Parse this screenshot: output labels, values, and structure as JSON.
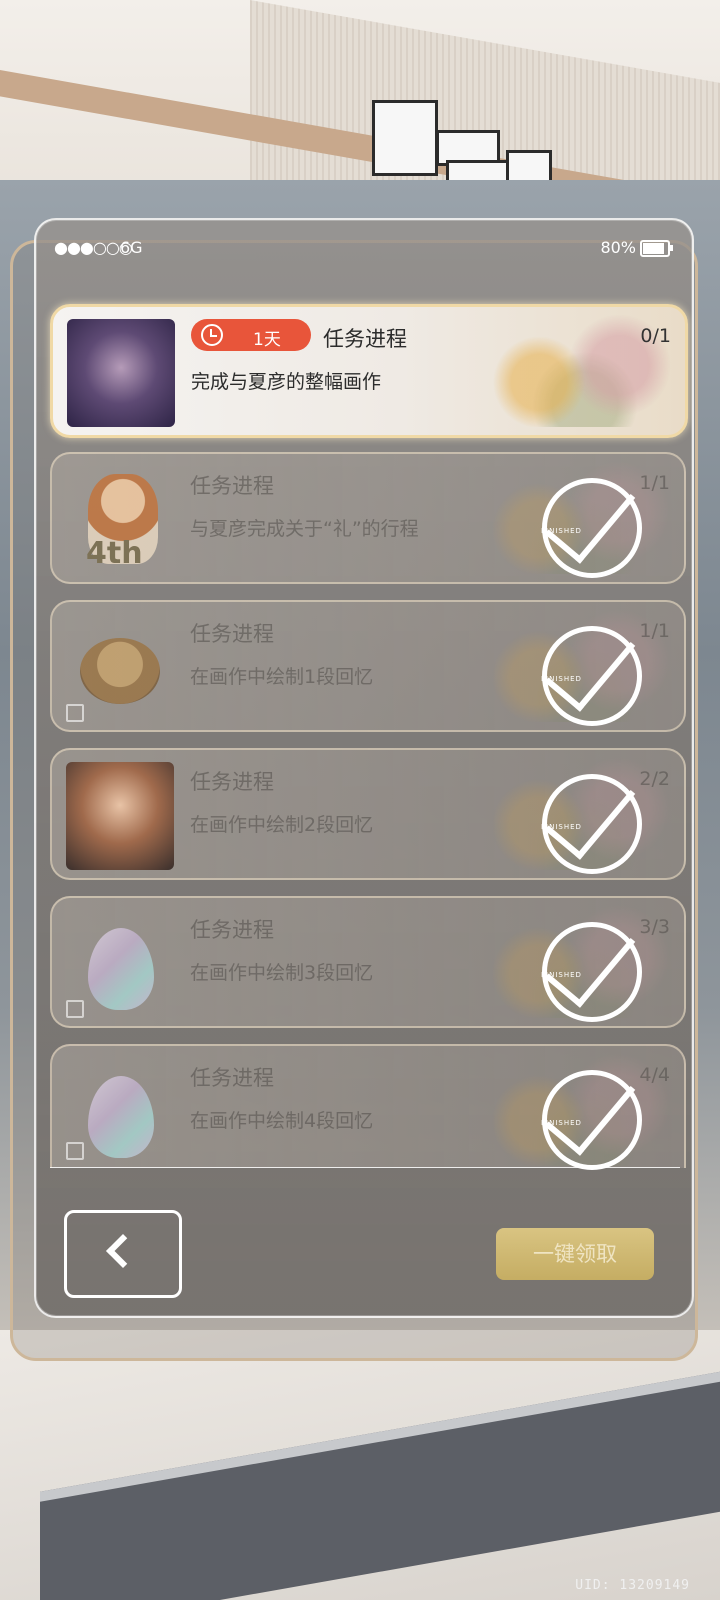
{
  "status_bar": {
    "signal": "●●●○○○",
    "network": "6G",
    "battery": "80%"
  },
  "tasks": [
    {
      "timer": "1天",
      "title": "任务进程",
      "description": "完成与夏彦的整幅画作",
      "progress": "0/1",
      "finished": false,
      "thumb": "portrait-icon"
    },
    {
      "title": "任务进程",
      "description": "与夏彦完成关于“礼”的行程",
      "progress": "1/1",
      "finished": true,
      "thumb": "chibi-4th-icon",
      "thumb_label": "4th"
    },
    {
      "title": "任务进程",
      "description": "在画作中绘制1段回忆",
      "progress": "1/1",
      "finished": true,
      "thumb": "cake-icon"
    },
    {
      "title": "任务进程",
      "description": "在画作中绘制2段回忆",
      "progress": "2/2",
      "finished": true,
      "thumb": "portrait-icon"
    },
    {
      "title": "任务进程",
      "description": "在画作中绘制3段回忆",
      "progress": "3/3",
      "finished": true,
      "thumb": "gem-icon"
    },
    {
      "title": "任务进程",
      "description": "在画作中绘制4段回忆",
      "progress": "4/4",
      "finished": true,
      "thumb": "gem-icon"
    }
  ],
  "finished_stamp": "FINISHED",
  "buttons": {
    "claim_all": "一键领取"
  },
  "uid": "UID: 13209149",
  "colors": {
    "timer_badge": "#e8553a",
    "claim_button": "#d9c482",
    "frame_border": "#cdb79a"
  }
}
